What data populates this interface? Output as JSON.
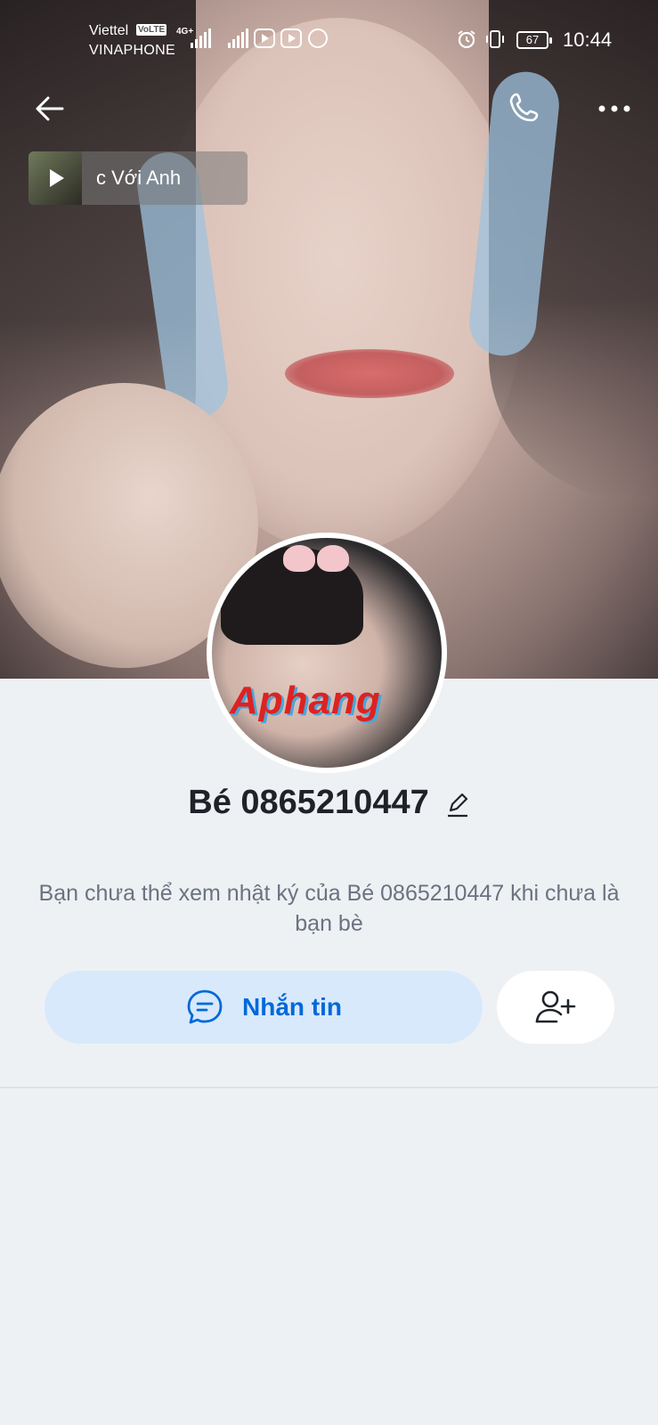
{
  "status_bar": {
    "carrier_1": "Viettel",
    "volte_badge": "VoLTE",
    "carrier_2": "VINAPHONE",
    "network": "4G+",
    "battery": "67",
    "time": "10:44"
  },
  "header": {
    "back_icon": "arrow-left-icon",
    "call_icon": "phone-icon",
    "more_icon": "more-horizontal-icon"
  },
  "music": {
    "title": "c Với Anh"
  },
  "profile": {
    "avatar_watermark": "Aphang",
    "name": "Bé 0865210447",
    "edit_icon": "pencil-icon",
    "notice": "Bạn chưa thể xem nhật ký của Bé 0865210447 khi chưa là bạn bè"
  },
  "actions": {
    "message_label": "Nhắn tin",
    "message_icon": "chat-bubble-icon",
    "add_friend_icon": "add-user-icon"
  },
  "colors": {
    "accent": "#0068d9",
    "message_button_bg": "#d8e9fc",
    "page_bg": "#eef1f4"
  }
}
